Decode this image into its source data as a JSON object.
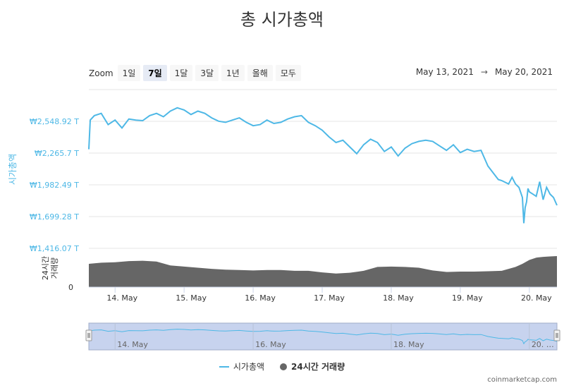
{
  "title": "총 시가총액",
  "zoom": {
    "label": "Zoom",
    "buttons": [
      "1일",
      "7일",
      "1달",
      "3달",
      "1년",
      "올해",
      "모두"
    ],
    "active": "7일"
  },
  "range": {
    "from": "May 13, 2021",
    "arrow": "→",
    "to": "May 20, 2021"
  },
  "legend": {
    "market_cap": "시가총액",
    "volume": "24시간 거래량"
  },
  "watermark": "coinmarketcap.com",
  "colors": {
    "line": "#4eb8e6",
    "volume": "#666666",
    "navigator_fill": "#c7d3ee"
  },
  "chart_data": {
    "type": "line",
    "title": "총 시가총액",
    "ylabel": "시가총액",
    "ylabel_volume": "24시간 거래량",
    "y_ticks": [
      "₩2,548.92 T",
      "₩2,265.7 T",
      "₩1,982.49 T",
      "₩1,699.28 T",
      "₩1,416.07 T"
    ],
    "y_tick_values": [
      2548.92,
      2265.7,
      1982.49,
      1699.28,
      1416.07
    ],
    "ylim": [
      1416.07,
      2832.13
    ],
    "volume_axis_tick": "0",
    "x_ticks": [
      "14. May",
      "15. May",
      "16. May",
      "17. May",
      "18. May",
      "19. May",
      "20. May"
    ],
    "x_tick_days": [
      14,
      15,
      16,
      17,
      18,
      19,
      20
    ],
    "xlim_days": [
      13.62,
      20.4
    ],
    "navigator_ticks": [
      "14. May",
      "16. May",
      "18. May",
      "20. …"
    ],
    "navigator_tick_days": [
      14,
      16,
      18,
      20
    ],
    "series": [
      {
        "name": "시가총액",
        "x_days": [
          13.62,
          13.64,
          13.7,
          13.8,
          13.9,
          14.0,
          14.1,
          14.2,
          14.3,
          14.4,
          14.5,
          14.6,
          14.7,
          14.8,
          14.9,
          15.0,
          15.1,
          15.2,
          15.3,
          15.4,
          15.5,
          15.6,
          15.7,
          15.8,
          15.9,
          16.0,
          16.1,
          16.2,
          16.3,
          16.4,
          16.5,
          16.6,
          16.7,
          16.8,
          16.9,
          17.0,
          17.1,
          17.2,
          17.3,
          17.4,
          17.5,
          17.6,
          17.7,
          17.8,
          17.9,
          18.0,
          18.1,
          18.2,
          18.3,
          18.4,
          18.5,
          18.6,
          18.7,
          18.8,
          18.9,
          19.0,
          19.1,
          19.2,
          19.3,
          19.4,
          19.5,
          19.55,
          19.6,
          19.7,
          19.75,
          19.8,
          19.85,
          19.9,
          19.92,
          19.94,
          19.96,
          19.98,
          20.0,
          20.05,
          20.1,
          20.15,
          20.2,
          20.25,
          20.3,
          20.35,
          20.4
        ],
        "values": [
          2300,
          2560,
          2600,
          2620,
          2520,
          2560,
          2490,
          2570,
          2560,
          2555,
          2600,
          2620,
          2590,
          2640,
          2670,
          2650,
          2610,
          2640,
          2620,
          2580,
          2550,
          2540,
          2560,
          2580,
          2540,
          2510,
          2520,
          2560,
          2530,
          2540,
          2570,
          2590,
          2600,
          2540,
          2510,
          2470,
          2410,
          2360,
          2380,
          2320,
          2260,
          2340,
          2390,
          2360,
          2280,
          2320,
          2240,
          2310,
          2350,
          2370,
          2380,
          2370,
          2330,
          2290,
          2340,
          2270,
          2300,
          2280,
          2290,
          2150,
          2070,
          2030,
          2020,
          1990,
          2050,
          1990,
          1960,
          1870,
          1640,
          1780,
          1830,
          1950,
          1920,
          1900,
          1880,
          2010,
          1850,
          1960,
          1900,
          1870,
          1800
        ]
      },
      {
        "name": "24시간 거래량",
        "x_days": [
          13.62,
          13.8,
          14.0,
          14.2,
          14.4,
          14.6,
          14.8,
          15.0,
          15.2,
          15.4,
          15.6,
          15.8,
          16.0,
          16.2,
          16.4,
          16.6,
          16.8,
          17.0,
          17.2,
          17.4,
          17.6,
          17.8,
          18.0,
          18.2,
          18.4,
          18.6,
          18.8,
          19.0,
          19.2,
          19.4,
          19.6,
          19.8,
          19.9,
          20.0,
          20.1,
          20.2,
          20.3,
          20.4
        ],
        "values": [
          0.6,
          0.63,
          0.64,
          0.67,
          0.68,
          0.66,
          0.56,
          0.53,
          0.5,
          0.47,
          0.45,
          0.44,
          0.43,
          0.44,
          0.44,
          0.42,
          0.42,
          0.38,
          0.35,
          0.37,
          0.42,
          0.52,
          0.53,
          0.52,
          0.5,
          0.43,
          0.39,
          0.4,
          0.4,
          0.41,
          0.42,
          0.52,
          0.6,
          0.7,
          0.76,
          0.78,
          0.79,
          0.8
        ]
      }
    ],
    "grid": true,
    "legend_position": "bottom-center"
  }
}
